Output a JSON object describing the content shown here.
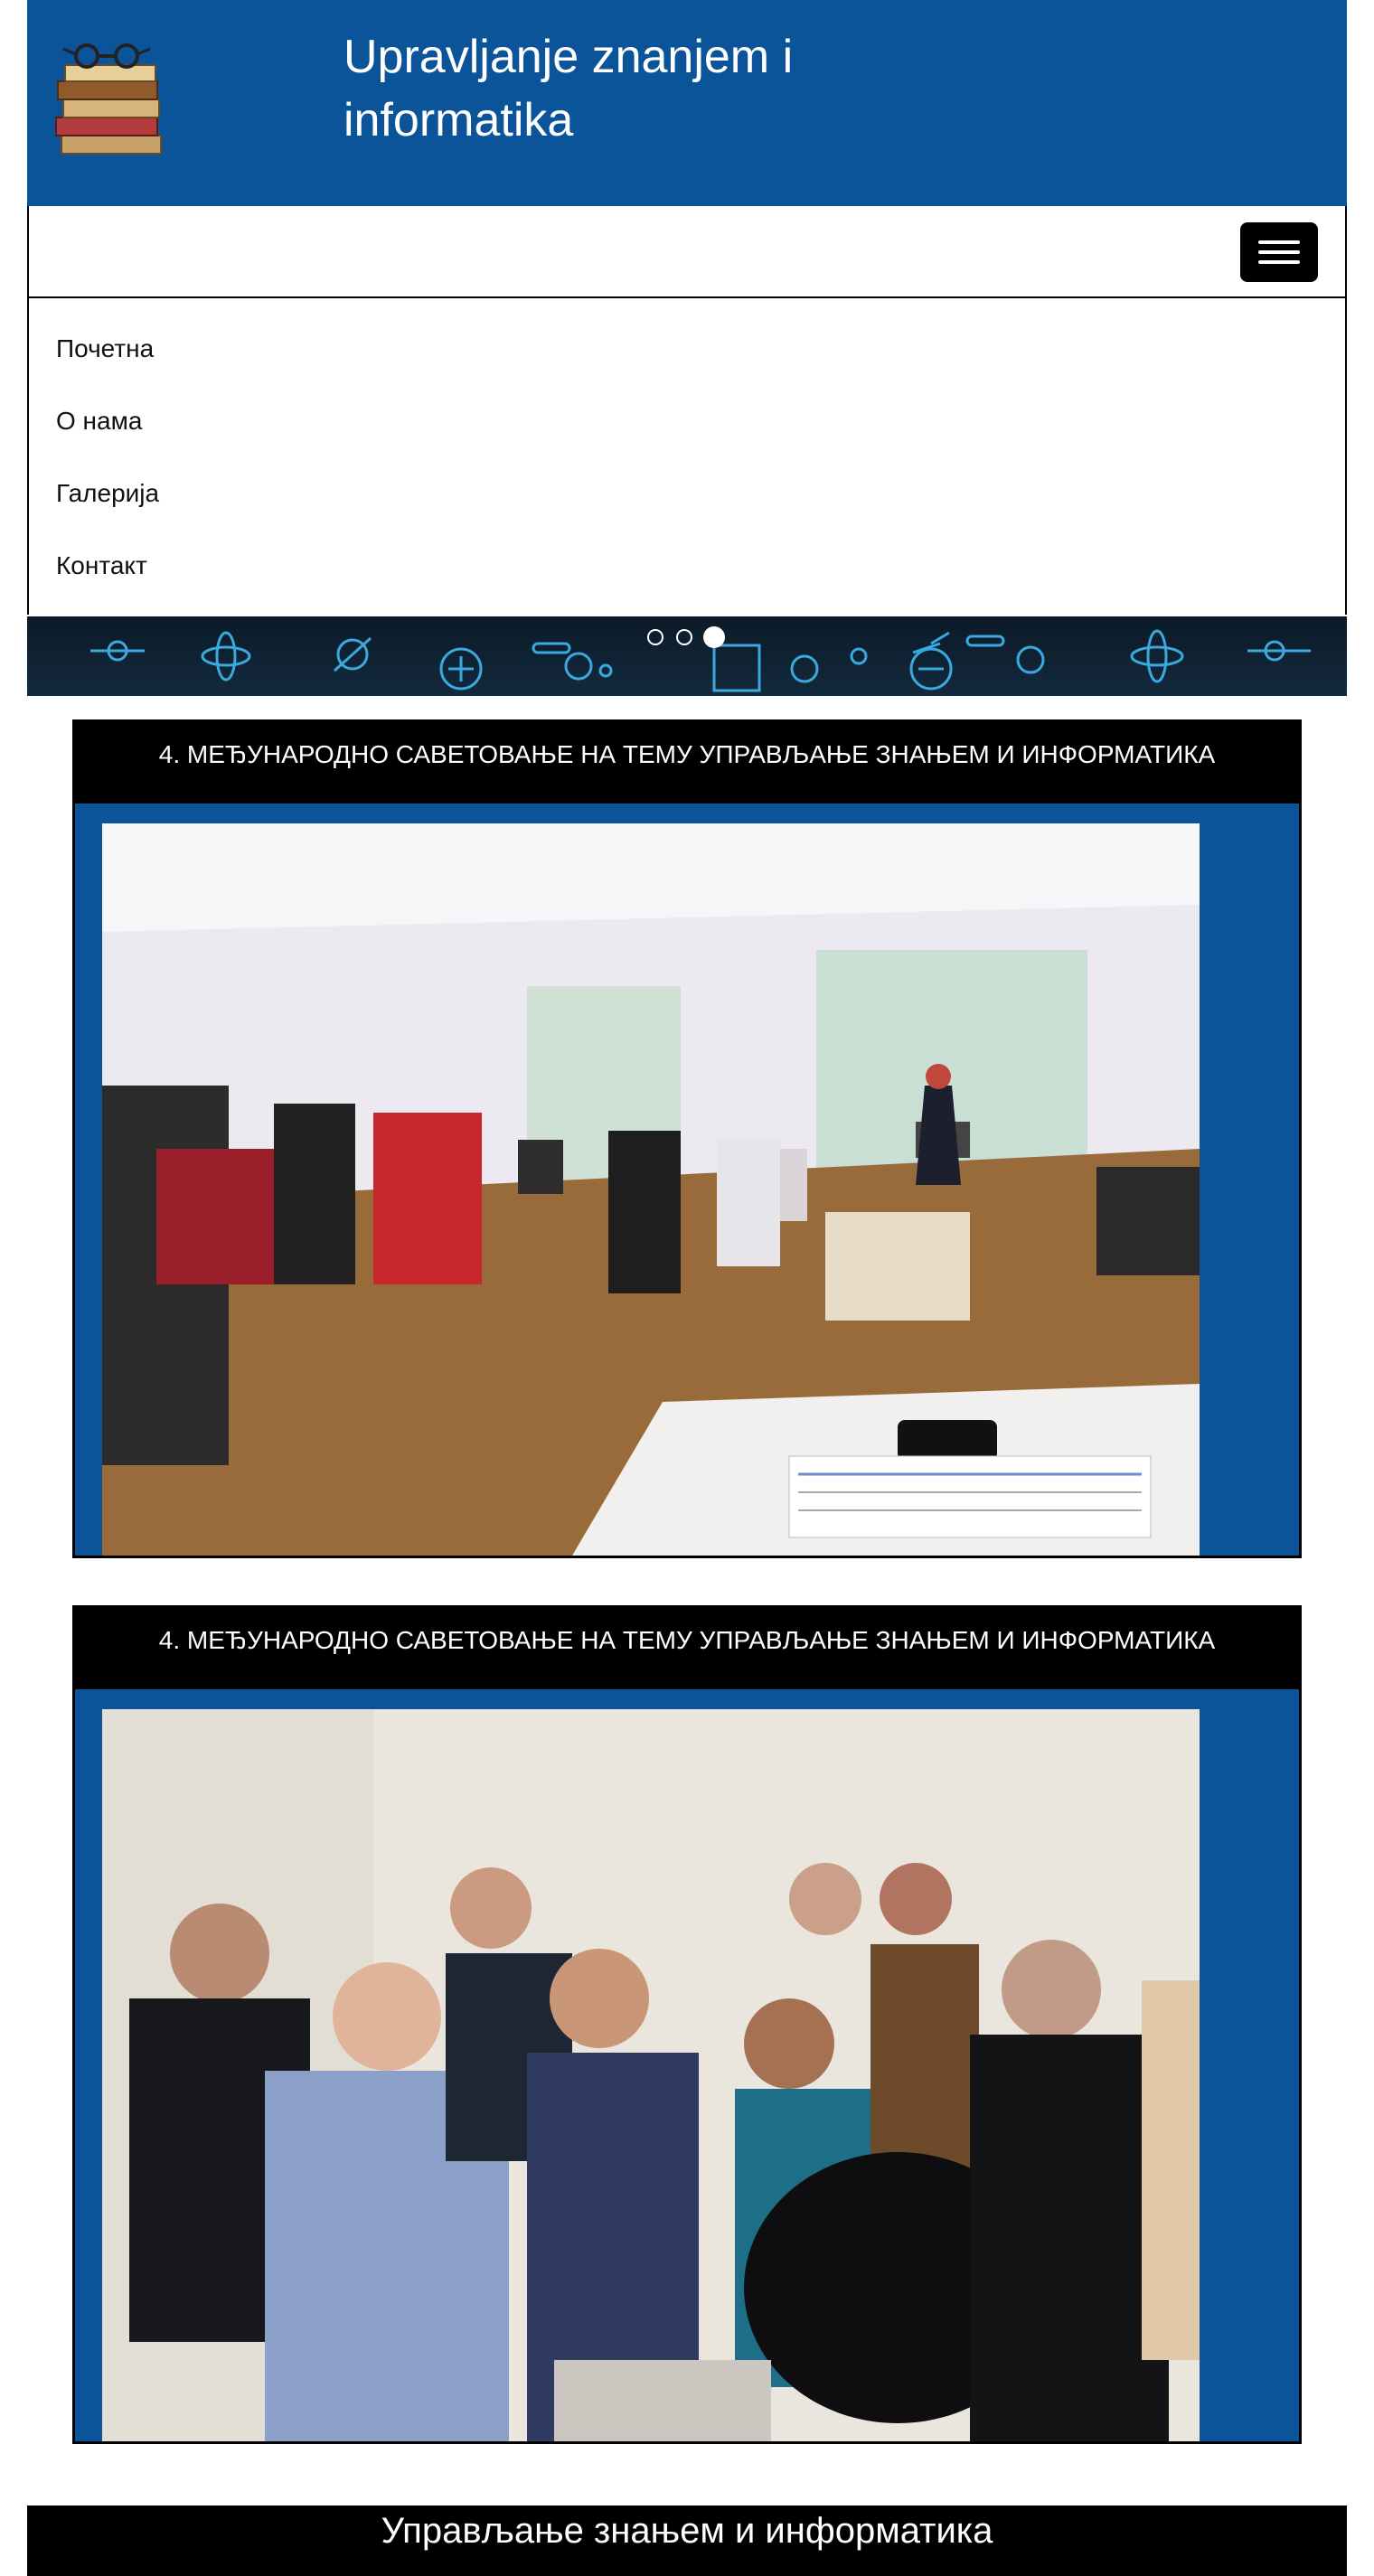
{
  "header": {
    "site_title": "Upravljanje znanjem i informatika",
    "bg_color": "#0b5499",
    "logo_icon": "books-icon"
  },
  "nav": {
    "toggle_icon": "hamburger-menu-icon",
    "items": [
      {
        "label": "Почетна"
      },
      {
        "label": "О нама"
      },
      {
        "label": "Галерија"
      },
      {
        "label": "Контакт"
      }
    ]
  },
  "carousel": {
    "slide_count": 3,
    "active_index": 2
  },
  "gallery": [
    {
      "title": "4. МЕЂУНАРОДНО САВЕТОВАЊЕ НА ТЕМУ УПРАВЉАЊЕ ЗНАЊЕМ И ИНФОРМАТИКА",
      "photo": "conference-room-presentation-photo"
    },
    {
      "title": "4. МЕЂУНАРОДНО САВЕТОВАЊЕ НА ТЕМУ УПРАВЉАЊЕ ЗНАЊЕМ И ИНФОРМАТИКА",
      "photo": "audience-seated-photo"
    }
  ],
  "footer": {
    "text": "Управљање знањем и информатика"
  }
}
